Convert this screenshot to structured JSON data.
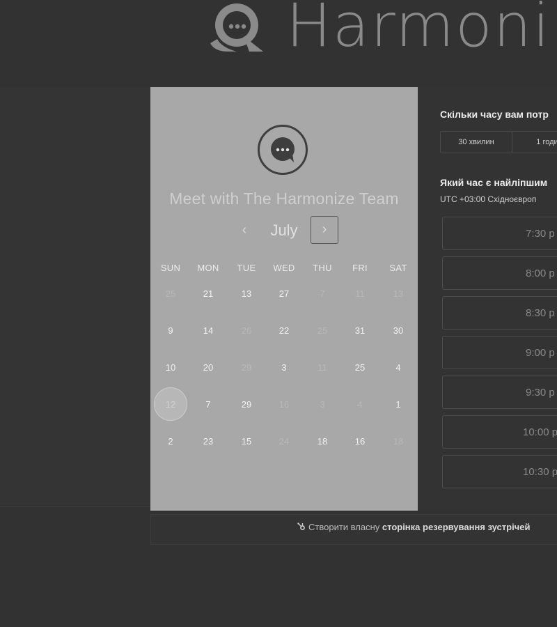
{
  "brand": {
    "name": "Harmoni",
    "logo_icon": "chat-bubble-logo-icon"
  },
  "card": {
    "title": "Meet with The Harmonize Team",
    "month": "July",
    "prev_symbol": "‹",
    "next_symbol": "›",
    "weekdays": [
      "SUN",
      "MON",
      "TUE",
      "WED",
      "THU",
      "FRI",
      "SAT"
    ],
    "weeks": [
      [
        {
          "d": "25",
          "m": true
        },
        {
          "d": "21"
        },
        {
          "d": "13"
        },
        {
          "d": "27"
        },
        {
          "d": "7",
          "m": true
        },
        {
          "d": "11",
          "m": true
        },
        {
          "d": "13",
          "m": true
        }
      ],
      [
        {
          "d": "9"
        },
        {
          "d": "14"
        },
        {
          "d": "26",
          "m": true
        },
        {
          "d": "22"
        },
        {
          "d": "25",
          "m": true
        },
        {
          "d": "31"
        },
        {
          "d": "30"
        }
      ],
      [
        {
          "d": "10"
        },
        {
          "d": "20"
        },
        {
          "d": "29",
          "m": true
        },
        {
          "d": "3"
        },
        {
          "d": "11",
          "m": true
        },
        {
          "d": "25"
        },
        {
          "d": "4"
        }
      ],
      [
        {
          "d": "12",
          "s": true
        },
        {
          "d": "7"
        },
        {
          "d": "29"
        },
        {
          "d": "16",
          "m": true
        },
        {
          "d": "3",
          "m": true
        },
        {
          "d": "4",
          "m": true
        },
        {
          "d": "1"
        }
      ],
      [
        {
          "d": "2"
        },
        {
          "d": "23"
        },
        {
          "d": "15"
        },
        {
          "d": "24",
          "m": true
        },
        {
          "d": "18"
        },
        {
          "d": "16"
        },
        {
          "d": "18",
          "m": true
        }
      ]
    ]
  },
  "right": {
    "duration_question": "Скільки часу вам потр",
    "durations": [
      "30 хвилин",
      "1 годи"
    ],
    "time_question": "Який час є найліпшим",
    "timezone": "UTC +03:00 Східноєвроп",
    "slots": [
      "7:30 р",
      "8:00 р",
      "8:30 р",
      "9:00 р",
      "9:30 р",
      "10:00 р",
      "10:30 р"
    ]
  },
  "footer": {
    "prefix": "Створити власну",
    "link": "сторінка резервування зустрічей",
    "icon": "hubspot-sprocket-icon"
  }
}
